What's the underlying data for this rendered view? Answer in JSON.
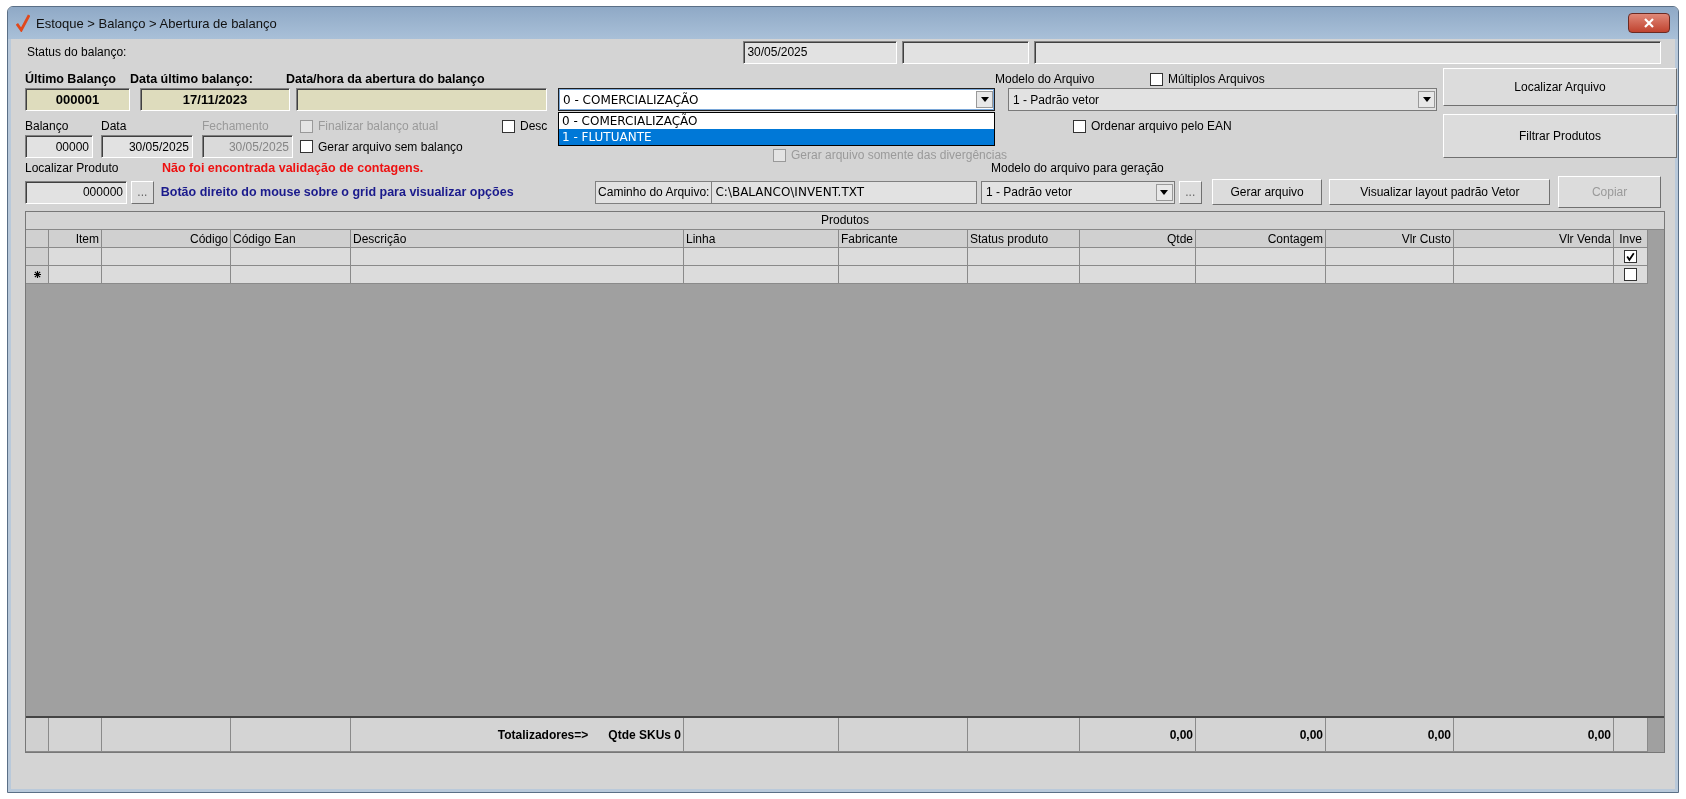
{
  "window": {
    "title": "Estoque > Balanço > Abertura de balanço"
  },
  "status": {
    "label": "Status do balanço:",
    "date": "30/05/2025"
  },
  "summary": [
    {
      "label": "Último Balanço",
      "value": "000001"
    },
    {
      "label": "Data último balanço:",
      "value": "17/11/2023"
    },
    {
      "label": "Data/hora da abertura do balanço"
    }
  ],
  "balance": [
    {
      "label": "Balanço",
      "value": "00000",
      "disabled": false
    },
    {
      "label": "Data",
      "value": "30/05/2025",
      "disabled": false
    },
    {
      "label": "Fechamento",
      "value": "30/05/2025",
      "disabled": true
    }
  ],
  "left_checks": [
    {
      "label": "Finalizar balanço atual",
      "checked": false,
      "disabled": true
    },
    {
      "label": "Gerar arquivo sem balanço",
      "checked": false,
      "disabled": false
    }
  ],
  "type_combo": {
    "value": "0 - COMERCIALIZAÇÃO",
    "expanded": true,
    "options": [
      {
        "label": "0 - COMERCIALIZAÇÃO",
        "highlighted": false
      },
      {
        "label": "1 - FLUTUANTE",
        "highlighted": true
      }
    ]
  },
  "desc_check": {
    "label": "Desc",
    "checked": false
  },
  "divergence_check": {
    "label": "Gerar arquivo somente das divergências",
    "checked": false,
    "disabled": true
  },
  "file_model": {
    "label": "Modelo do Arquivo",
    "value": "1 - Padrão vetor"
  },
  "multiple_files": {
    "label": "Múltiplos Arquivos",
    "checked": false
  },
  "order_ean": {
    "label": "Ordenar arquivo pelo EAN",
    "checked": false
  },
  "side_buttons": [
    {
      "label": "Localizar Arquivo",
      "disabled": false
    },
    {
      "label": "Filtrar Produtos",
      "disabled": false
    }
  ],
  "product_search": {
    "label": "Localizar Produto",
    "value": "000000",
    "browse": "..."
  },
  "messages": [
    {
      "text": "Não foi encontrada validação de contagens.",
      "kind": "error"
    },
    {
      "text": "Botão direito do mouse sobre o grid para visualizar opções",
      "kind": "hint"
    }
  ],
  "file_path": {
    "label": "Caminho do Arquivo:",
    "value": "C:\\BALANCO\\INVENT.TXT"
  },
  "generation_model": {
    "label": "Modelo do arquivo para geração",
    "value": "1 - Padrão vetor",
    "browse": "..."
  },
  "actions": [
    {
      "label": "Gerar arquivo",
      "disabled": false
    },
    {
      "label": "Visualizar layout padrão Vetor",
      "disabled": false
    },
    {
      "label": "Copiar",
      "disabled": true
    }
  ],
  "grid": {
    "title": "Produtos",
    "columns": [
      {
        "label": "Item",
        "kind": "number"
      },
      {
        "label": "Código",
        "kind": "number"
      },
      {
        "label": "Código Ean",
        "kind": "text"
      },
      {
        "label": "Descrição",
        "kind": "text"
      },
      {
        "label": "Linha",
        "kind": "text"
      },
      {
        "label": "Fabricante",
        "kind": "text"
      },
      {
        "label": "Status produto",
        "kind": "text"
      },
      {
        "label": "Qtde",
        "kind": "number"
      },
      {
        "label": "Contagem",
        "kind": "number"
      },
      {
        "label": "Vlr Custo",
        "kind": "number"
      },
      {
        "label": "Vlr Venda",
        "kind": "number"
      },
      {
        "label": "Inve",
        "kind": "check"
      }
    ],
    "rows": [
      {
        "new_record": false,
        "checked": true
      },
      {
        "new_record": true,
        "checked": false
      }
    ],
    "totals": {
      "label": "Totalizadores=>",
      "skus": "Qtde SKUs 0",
      "values": [
        "0,00",
        "0,00",
        "0,00",
        "0,00"
      ]
    }
  }
}
